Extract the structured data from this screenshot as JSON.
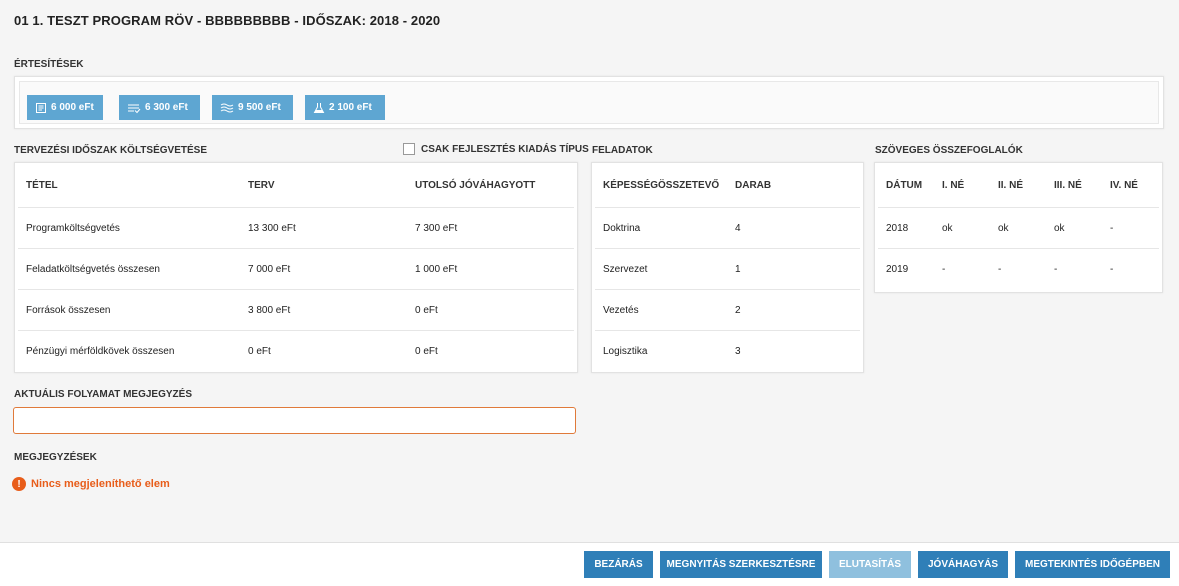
{
  "page": {
    "title": "01 1. TESZT PROGRAM RÖV - BBBBBBBBB - IDŐSZAK: 2018 - 2020"
  },
  "notifications": {
    "label": "ÉRTESÍTÉSEK",
    "badges": [
      {
        "icon": "document-lines-icon",
        "value": "6 000 eFt"
      },
      {
        "icon": "list-check-icon",
        "value": "6 300 eFt"
      },
      {
        "icon": "waves-icon",
        "value": "9 500 eFt"
      },
      {
        "icon": "flask-icon",
        "value": "2 100 eFt"
      }
    ],
    "badge_color": "#5ea6d2"
  },
  "budget": {
    "label": "TERVEZÉSI IDŐSZAK KÖLTSÉGVETÉSE",
    "checkbox_label": "CSAK FEJLESZTÉS KIADÁS TÍPUS",
    "columns": [
      "TÉTEL",
      "TERV",
      "UTOLSÓ JÓVÁHAGYOTT"
    ],
    "rows": [
      [
        "Programköltségvetés",
        "13 300 eFt",
        "7 300 eFt"
      ],
      [
        "Feladatköltségvetés összesen",
        "7 000 eFt",
        "1 000 eFt"
      ],
      [
        "Források összesen",
        "3 800 eFt",
        "0 eFt"
      ],
      [
        "Pénzügyi mérföldkövek összesen",
        "0 eFt",
        "0 eFt"
      ]
    ]
  },
  "tasks": {
    "label": "FELADATOK",
    "columns": [
      "KÉPESSÉGÖSSZETEVŐ",
      "DARAB"
    ],
    "rows": [
      [
        "Doktrina",
        "4"
      ],
      [
        "Szervezet",
        "1"
      ],
      [
        "Vezetés",
        "2"
      ],
      [
        "Logisztika",
        "3"
      ]
    ]
  },
  "summaries": {
    "label": "SZÖVEGES ÖSSZEFOGLALÓK",
    "columns": [
      "DÁTUM",
      "I. NÉ",
      "II. NÉ",
      "III. NÉ",
      "IV. NÉ"
    ],
    "rows": [
      [
        "2018",
        "ok",
        "ok",
        "ok",
        "-"
      ],
      [
        "2019",
        "-",
        "-",
        "-",
        "-"
      ]
    ]
  },
  "current_note": {
    "label": "AKTUÁLIS FOLYAMAT MEGJEGYZÉS",
    "value": "",
    "border_color": "#e07a3a"
  },
  "notes": {
    "label": "MEGJEGYZÉSEK",
    "empty_message": "Nincs megjeleníthető elem",
    "warning_color": "#e85d1a"
  },
  "footer": {
    "buttons": [
      {
        "label": "BEZÁRÁS",
        "enabled": true
      },
      {
        "label": "MEGNYITÁS SZERKESZTÉSRE",
        "enabled": true
      },
      {
        "label": "ELUTASÍTÁS",
        "enabled": false
      },
      {
        "label": "JÓVÁHAGYÁS",
        "enabled": true
      },
      {
        "label": "MEGTEKINTÉS IDŐGÉPBEN",
        "enabled": true
      }
    ],
    "button_color": "#2f7fb8"
  }
}
